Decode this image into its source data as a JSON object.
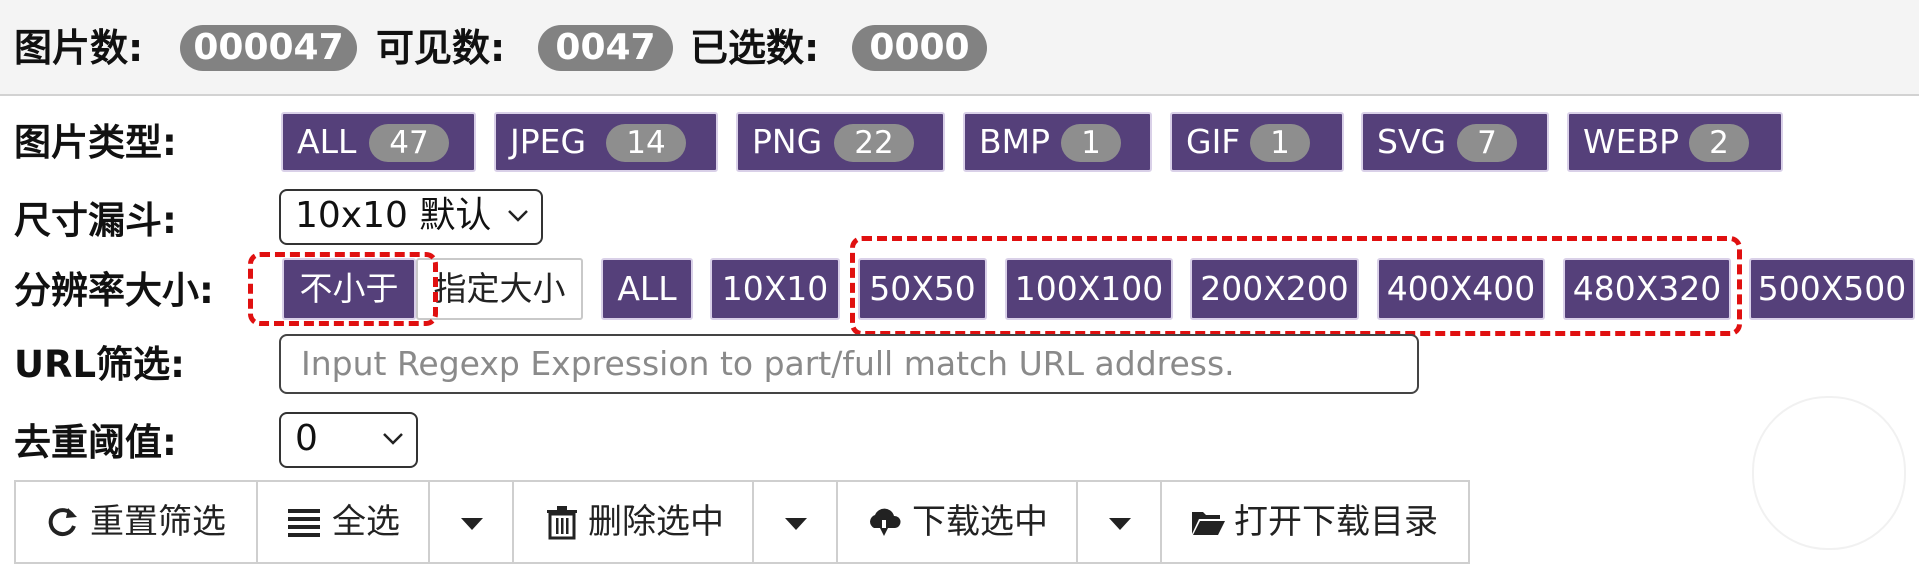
{
  "header": {
    "images_label": "图片数:",
    "images_count": "000047",
    "visible_label": "可见数:",
    "visible_count": "0047",
    "selected_label": "已选数:",
    "selected_count": "0000"
  },
  "type_row": {
    "label": "图片类型:",
    "buttons": [
      {
        "label": "ALL",
        "count": "47"
      },
      {
        "label": "JPEG",
        "count": "14"
      },
      {
        "label": "PNG",
        "count": "22"
      },
      {
        "label": "BMP",
        "count": "1"
      },
      {
        "label": "GIF",
        "count": "1"
      },
      {
        "label": "SVG",
        "count": "7"
      },
      {
        "label": "WEBP",
        "count": "2"
      }
    ]
  },
  "size_row": {
    "label": "尺寸漏斗:",
    "value": "10x10 默认"
  },
  "resolution_row": {
    "label": "分辨率大小:",
    "mode_selected": "不小于",
    "mode_other": "指定大小",
    "options": [
      "ALL",
      "10X10",
      "50X50",
      "100X100",
      "200X200",
      "400X400",
      "480X320",
      "500X500"
    ]
  },
  "url_row": {
    "label": "URL筛选:",
    "placeholder": "Input Regexp Expression to part/full match URL address."
  },
  "dedup_row": {
    "label": "去重阈值:",
    "value": "0"
  },
  "toolbar": {
    "reset": "重置筛选",
    "select_all": "全选",
    "delete_selected": "删除选中",
    "download_selected": "下载选中",
    "open_download_dir": "打开下载目录"
  },
  "colors": {
    "accent": "#55407a",
    "badge": "#828282",
    "highlight": "#e01010"
  },
  "icons": [
    "refresh-icon",
    "list-icon",
    "caret-down-icon",
    "trash-icon",
    "cloud-download-icon",
    "folder-open-icon"
  ]
}
